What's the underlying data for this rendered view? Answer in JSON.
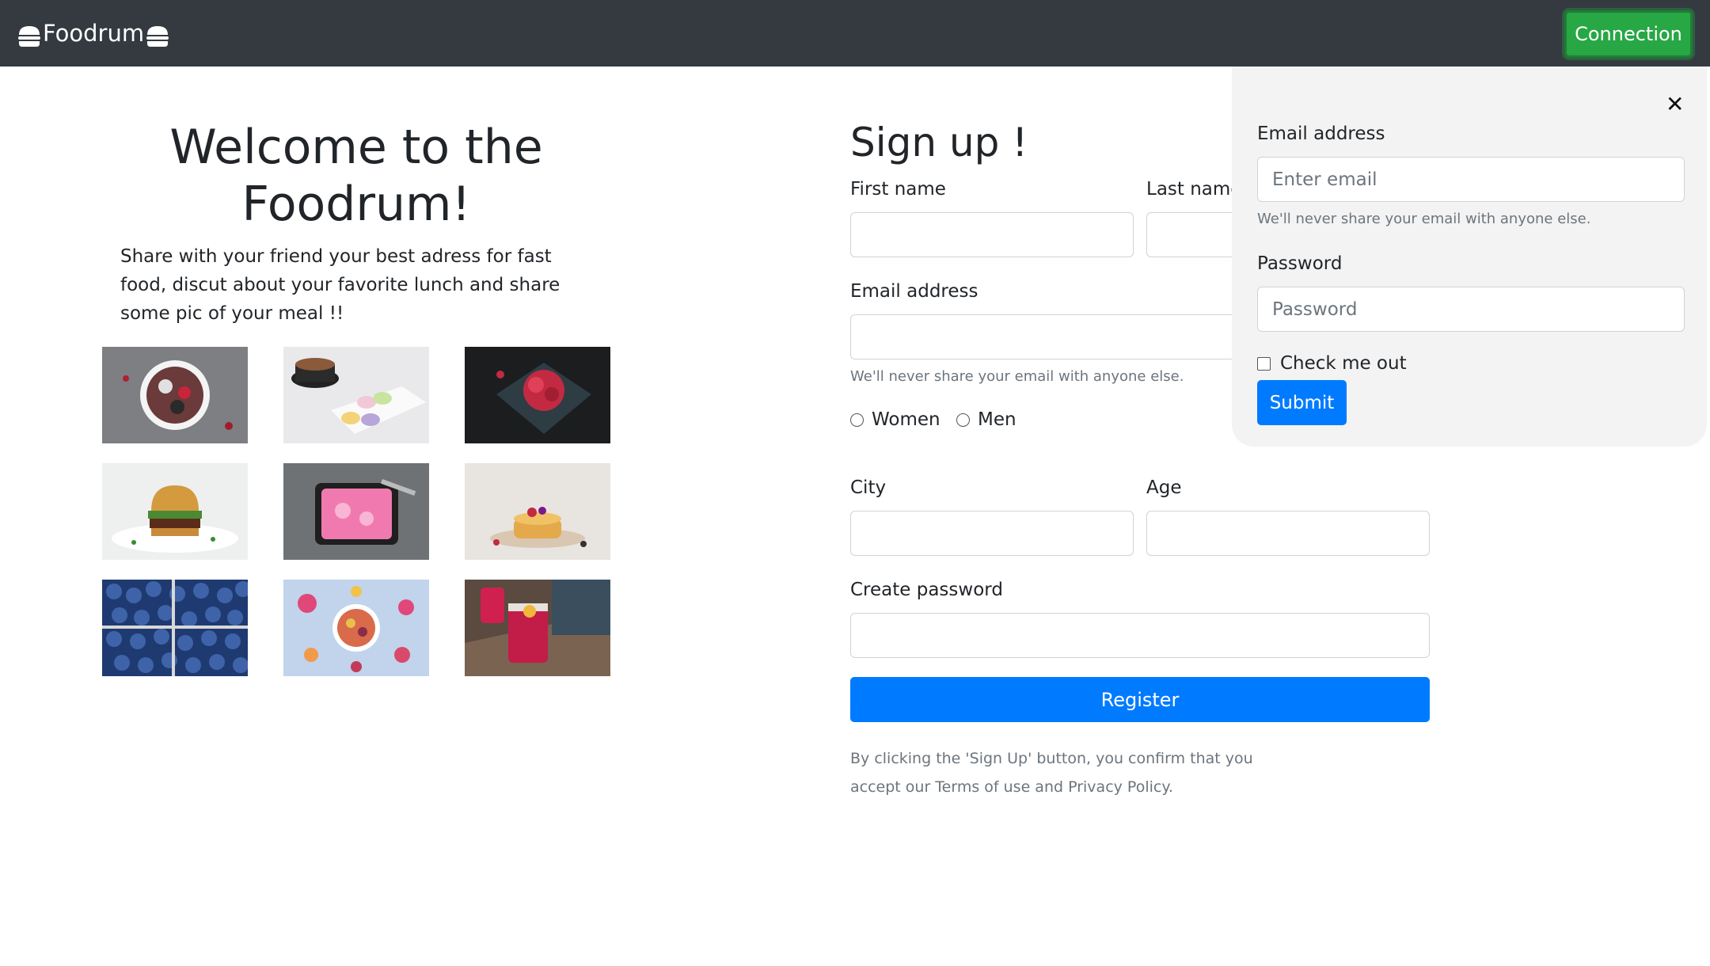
{
  "navbar": {
    "brand": "Foodrum",
    "brand_icon": "burger-icon",
    "connection_label": "Connection"
  },
  "welcome": {
    "title": "Welcome to the Foodrum!",
    "text": "Share with your friend your best adress for fast food, discut about your favorite lunch and share some pic of your meal !!"
  },
  "gallery": [
    {
      "name": "acai-bowl"
    },
    {
      "name": "coffee-macarons"
    },
    {
      "name": "raspberry-dessert"
    },
    {
      "name": "burger"
    },
    {
      "name": "pink-ice-cream"
    },
    {
      "name": "pancakes-berries"
    },
    {
      "name": "blueberries"
    },
    {
      "name": "fruit-bowl"
    },
    {
      "name": "red-drink"
    }
  ],
  "signup": {
    "title": "Sign up !",
    "first_name_label": "First name",
    "last_name_label": "Last name",
    "email_label": "Email address",
    "email_help": "We'll never share your email with anyone else.",
    "gender_options": [
      "Women",
      "Men"
    ],
    "city_label": "City",
    "age_label": "Age",
    "password_label": "Create password",
    "register_label": "Register",
    "terms_text": "By clicking the 'Sign Up' button, you confirm that you accept our Terms of use and Privacy Policy."
  },
  "login": {
    "close_icon": "close-icon",
    "email_label": "Email address",
    "email_placeholder": "Enter email",
    "email_help": "We'll never share your email with anyone else.",
    "password_label": "Password",
    "password_placeholder": "Password",
    "check_label": "Check me out",
    "submit_label": "Submit"
  },
  "colors": {
    "navbar_bg": "#343a40",
    "connection_green": "#28a745",
    "primary_blue": "#007bff",
    "popover_bg": "#f3f3f3"
  }
}
